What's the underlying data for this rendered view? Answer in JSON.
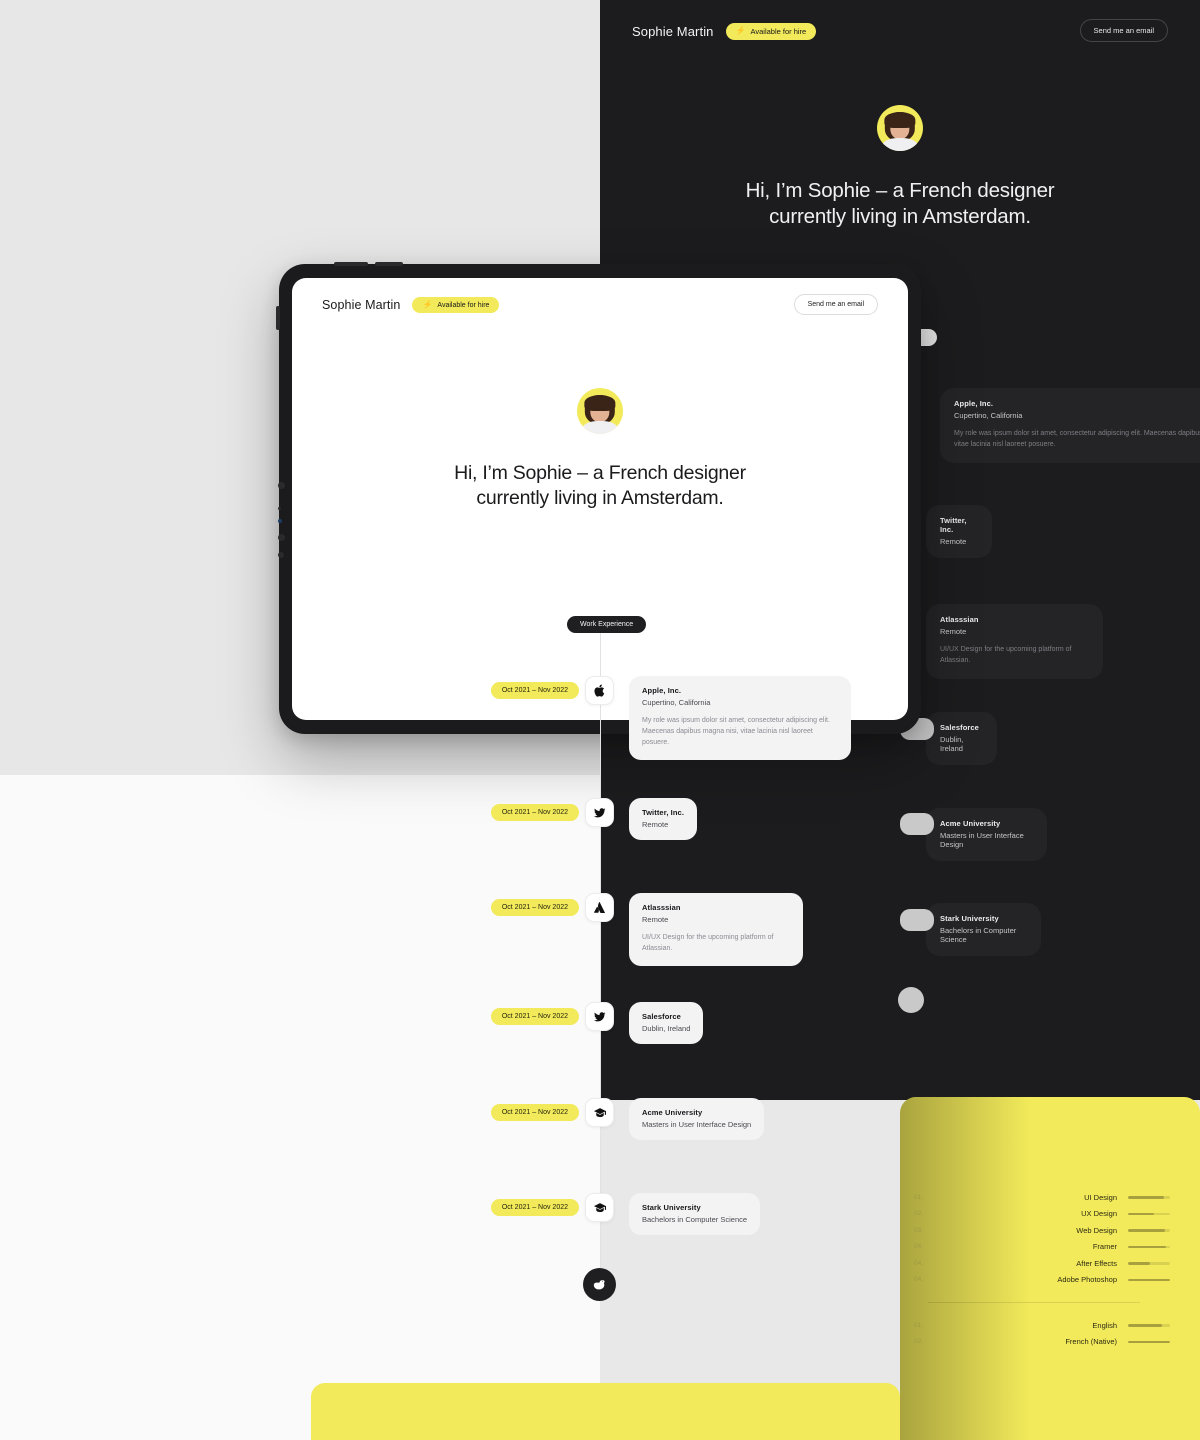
{
  "brand": {
    "accent": "#f2ea5a",
    "dark": "#1c1c1e",
    "page_bg": "#e7e7e7"
  },
  "site": {
    "name": "Sophie Martin",
    "badge": {
      "label": "Available for hire",
      "icon": "bolt-icon"
    },
    "cta": {
      "label": "Send me an email"
    },
    "hero": {
      "avatar_alt": "Sophie Martin portrait",
      "headline_line1": "Hi, I’m Sophie – a French designer",
      "headline_line2": "currently living in Amsterdam."
    },
    "section_chip": "Work Experience",
    "timeline": [
      {
        "date": "Oct 2021 – Nov 2022",
        "icon": "apple-icon",
        "title": "Apple, Inc.",
        "subtitle": "Cupertino, California",
        "description": "My role was ipsum dolor sit amet, consectetur adipiscing elit. Maecenas dapibus magna nisi, vitae lacinia nisl laoreet posuere."
      },
      {
        "date": "Oct 2021 – Nov 2022",
        "icon": "twitter-icon",
        "title": "Twitter, Inc.",
        "subtitle": "Remote",
        "description": ""
      },
      {
        "date": "Oct 2021 – Nov 2022",
        "icon": "atlassian-icon",
        "title": "Atlasssian",
        "subtitle": "Remote",
        "description": "UI/UX Design for the upcoming platform of Atlassian."
      },
      {
        "date": "Oct 2021 – Nov 2022",
        "icon": "twitter-icon",
        "title": "Salesforce",
        "subtitle": "Dublin, Ireland",
        "description": ""
      },
      {
        "date": "Oct 2021 – Nov 2022",
        "icon": "graduation-cap-icon",
        "title": "Acme University",
        "subtitle": "Masters in User Interface Design",
        "description": ""
      },
      {
        "date": "Oct 2021 – Nov 2022",
        "icon": "graduation-cap-icon",
        "title": "Stark University",
        "subtitle": "Bachelors in Computer Science",
        "description": ""
      }
    ],
    "timeline_end_icon": "duck-icon"
  },
  "skills_panel": {
    "skills": [
      {
        "num": "01.",
        "label": "UI Design",
        "value": 85
      },
      {
        "num": "02.",
        "label": "UX Design",
        "value": 62
      },
      {
        "num": "03.",
        "label": "Web Design",
        "value": 88
      },
      {
        "num": "04.",
        "label": "Framer",
        "value": 90
      },
      {
        "num": "04.",
        "label": "After Effects",
        "value": 53
      },
      {
        "num": "04.",
        "label": "Adobe Photoshop",
        "value": 100
      }
    ],
    "languages": [
      {
        "num": "01.",
        "label": "English",
        "value": 80
      },
      {
        "num": "02.",
        "label": "French (Native)",
        "value": 100
      }
    ]
  }
}
